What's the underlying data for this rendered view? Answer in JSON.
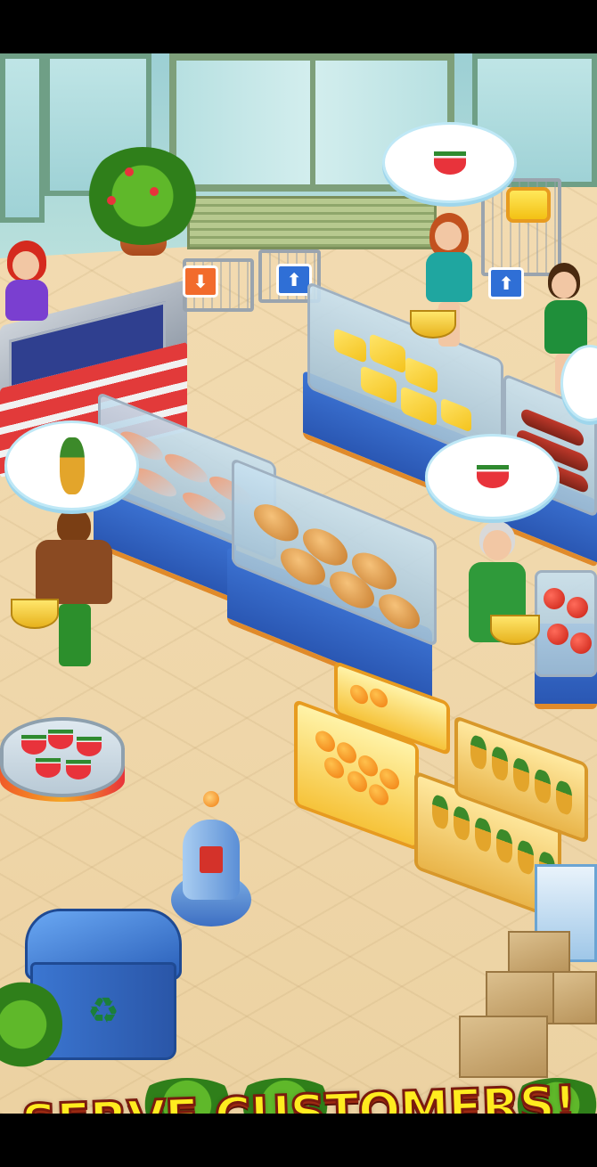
{
  "banner": {
    "text": "SERVE CUSTOMERS!",
    "color": "#ffec1f",
    "outline": "#7a1a0e"
  },
  "signs": {
    "arrow_up": "⬆",
    "arrow_down": "⬇"
  },
  "bubbles": [
    {
      "item": "watermelon-slice-icon"
    },
    {
      "item": "watermelon-slice-icon"
    },
    {
      "item": "pineapple-icon"
    }
  ],
  "icons": {
    "recycle": "♻"
  },
  "palette": {
    "floor": "#f0d8ac",
    "case_base": "#2a57b3",
    "counter_stripe": "#e23a3a"
  }
}
